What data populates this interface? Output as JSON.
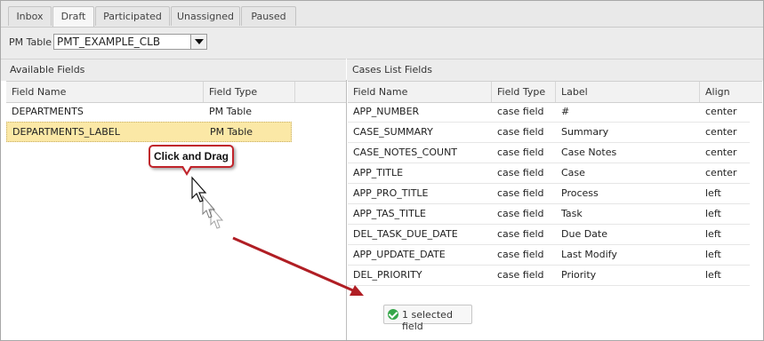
{
  "tabs": [
    "Inbox",
    "Draft",
    "Participated",
    "Unassigned",
    "Paused"
  ],
  "active_tab": "Draft",
  "pm_table": {
    "label": "PM Table",
    "value": "PMT_EXAMPLE_CLB"
  },
  "available": {
    "title": "Available Fields",
    "columns": [
      "Field Name",
      "Field Type"
    ],
    "rows": [
      [
        "DEPARTMENTS",
        "PM Table"
      ],
      [
        "DEPARTMENTS_LABEL",
        "PM Table"
      ]
    ]
  },
  "cases": {
    "title": "Cases List Fields",
    "columns": [
      "Field Name",
      "Field Type",
      "Label",
      "Align"
    ],
    "rows": [
      [
        "APP_NUMBER",
        "case field",
        "#",
        "center"
      ],
      [
        "CASE_SUMMARY",
        "case field",
        "Summary",
        "center"
      ],
      [
        "CASE_NOTES_COUNT",
        "case field",
        "Case Notes",
        "center"
      ],
      [
        "APP_TITLE",
        "case field",
        "Case",
        "center"
      ],
      [
        "APP_PRO_TITLE",
        "case field",
        "Process",
        "left"
      ],
      [
        "APP_TAS_TITLE",
        "case field",
        "Task",
        "left"
      ],
      [
        "DEL_TASK_DUE_DATE",
        "case field",
        "Due Date",
        "left"
      ],
      [
        "APP_UPDATE_DATE",
        "case field",
        "Last Modify",
        "left"
      ],
      [
        "DEL_PRIORITY",
        "case field",
        "Priority",
        "left"
      ]
    ]
  },
  "tooltip": "Click and Drag",
  "drag_status": "1 selected field",
  "colors": {
    "selected_row": "#fbe8a6",
    "arrow": "#b01e24",
    "ok": "#36a74a"
  }
}
